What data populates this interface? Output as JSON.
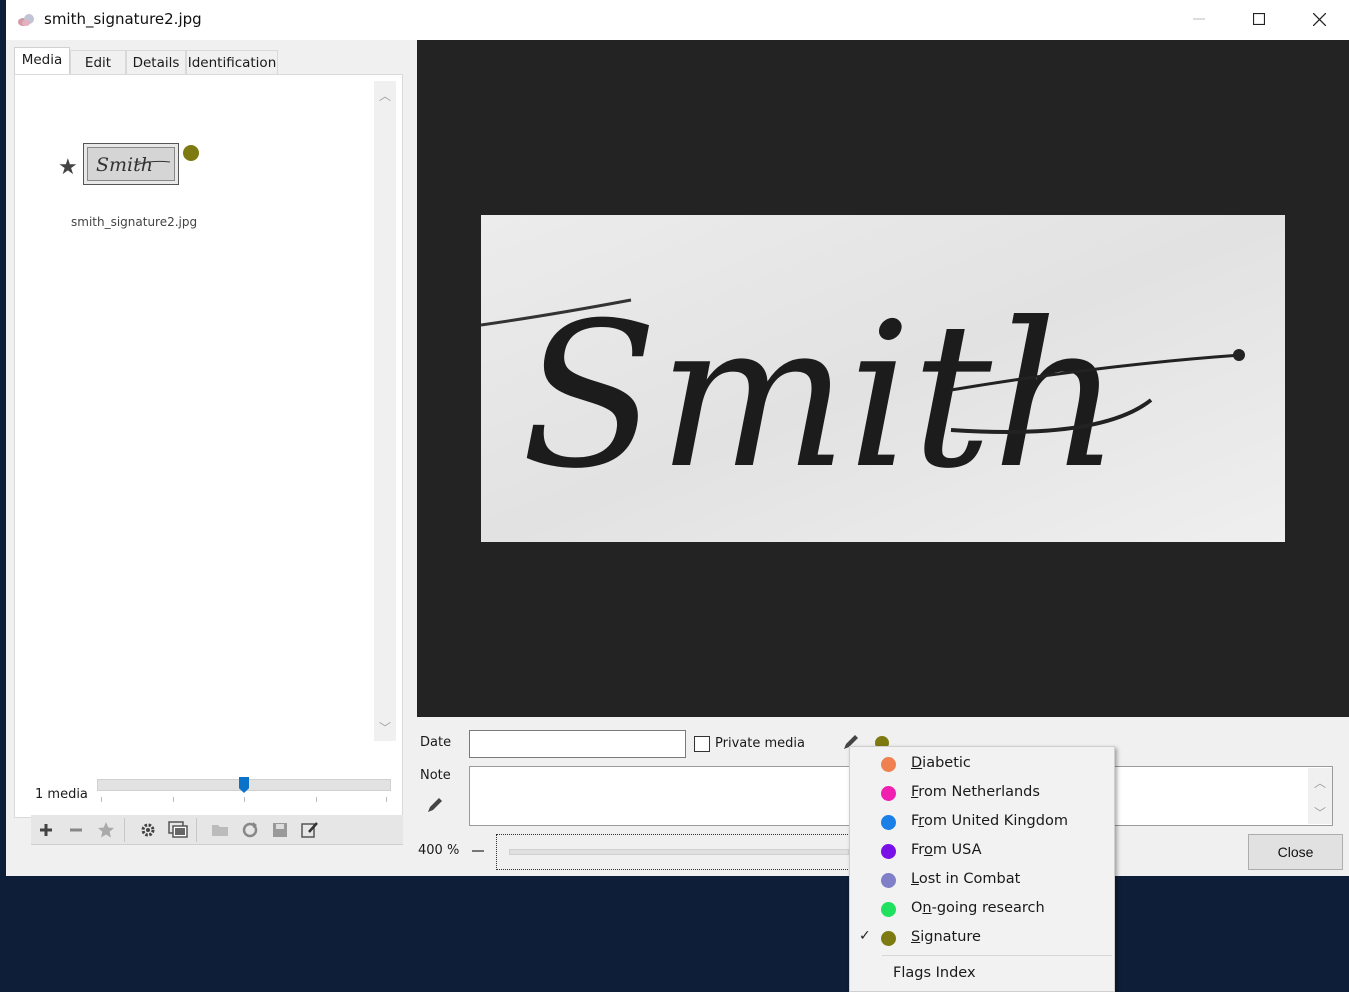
{
  "window": {
    "title": "smith_signature2.jpg"
  },
  "tabs": [
    {
      "label": "Media"
    },
    {
      "label": "Edit"
    },
    {
      "label": "Details"
    },
    {
      "label": "Identification"
    }
  ],
  "media_list": {
    "items": [
      {
        "filename": "smith_signature2.jpg",
        "thumbnail_text": "Smith",
        "flag_color": "#7e7a12"
      }
    ],
    "count_label": "1 media"
  },
  "toolbar_icons": [
    "add-icon",
    "remove-icon",
    "star-icon",
    "gear-icon",
    "slideshow-icon",
    "folder-icon",
    "refresh-icon",
    "save-icon",
    "edit-icon"
  ],
  "viewer": {
    "signature_text": "Smith"
  },
  "form": {
    "date_label": "Date",
    "date_value": "",
    "private_label": "Private media",
    "private_checked": false,
    "note_label": "Note",
    "note_value": ""
  },
  "zoom": {
    "label": "400 %"
  },
  "close_label": "Close",
  "flags_menu": {
    "items": [
      {
        "pre": "",
        "acc": "D",
        "post": "iabetic",
        "color": "#f08050",
        "checked": false
      },
      {
        "pre": "",
        "acc": "F",
        "post": "rom Netherlands",
        "color": "#f020b0",
        "checked": false
      },
      {
        "pre": "F",
        "acc": "r",
        "post": "om United Kingdom",
        "color": "#1a80e8",
        "checked": false
      },
      {
        "pre": "Fr",
        "acc": "o",
        "post": "m USA",
        "color": "#7a10e8",
        "checked": false
      },
      {
        "pre": "",
        "acc": "L",
        "post": "ost in Combat",
        "color": "#8080c8",
        "checked": false
      },
      {
        "pre": "O",
        "acc": "n",
        "post": "-going research",
        "color": "#20e060",
        "checked": false
      },
      {
        "pre": "",
        "acc": "S",
        "post": "ignature",
        "color": "#7e7a12",
        "checked": true,
        "check_glyph": "✓"
      }
    ],
    "index_label": "Flags Index"
  },
  "colors": {
    "viewer_bg": "#232323",
    "desktop_bg": "#0f1e38",
    "accent": "#0a72c9"
  }
}
